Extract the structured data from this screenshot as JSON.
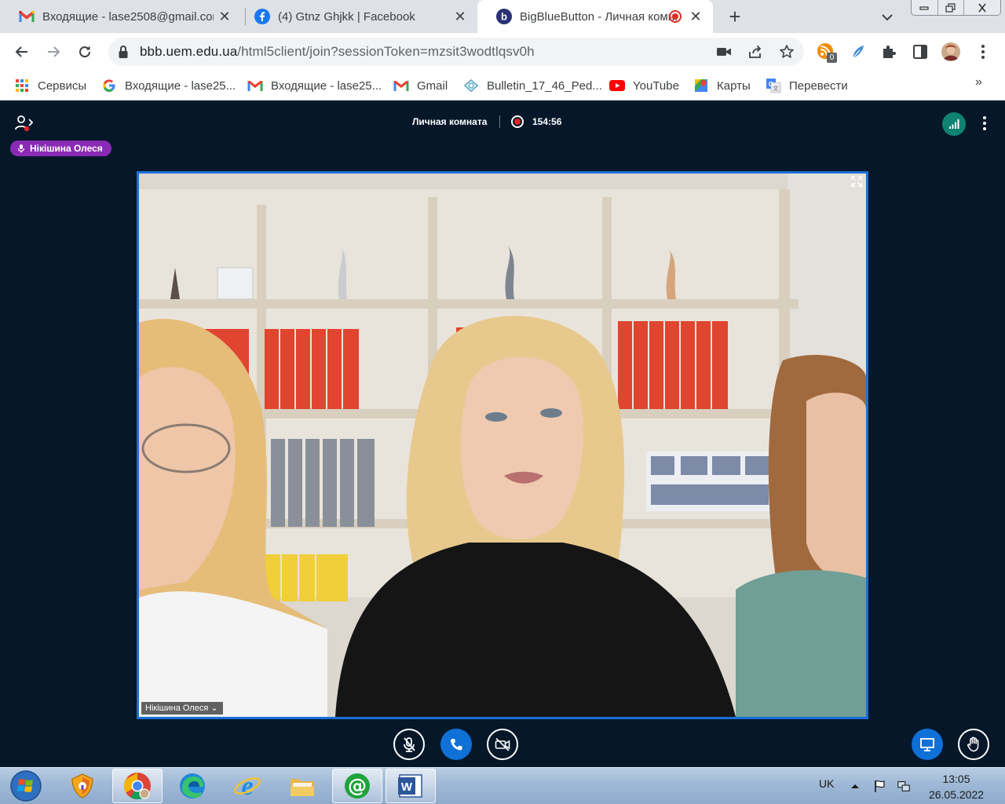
{
  "browser": {
    "tabs": [
      {
        "title": "Входящие - lase2508@gmail.com",
        "icon": "gmail-icon"
      },
      {
        "title": "(4) Gtnz Ghjkk | Facebook",
        "icon": "facebook-icon"
      },
      {
        "title": "BigBlueButton - Личная комната",
        "icon": "bigbluebutton-icon",
        "active": true,
        "recording": true
      }
    ],
    "url": {
      "host": "bbb.uem.edu.ua",
      "path": "/html5client/join?sessionToken=mzsit3wodtlqsv0h"
    },
    "extension_badge": "0",
    "bookmarks": [
      {
        "label": "Сервисы",
        "icon": "apps-grid-icon"
      },
      {
        "label": "Входящие - lase25...",
        "icon": "google-icon"
      },
      {
        "label": "Входящие - lase25...",
        "icon": "gmail-icon"
      },
      {
        "label": "Gmail",
        "icon": "gmail-icon"
      },
      {
        "label": "Bulletin_17_46_Ped...",
        "icon": "bulletin-icon"
      },
      {
        "label": "YouTube",
        "icon": "youtube-icon"
      },
      {
        "label": "Карты",
        "icon": "maps-icon"
      },
      {
        "label": "Перевести",
        "icon": "translate-icon"
      }
    ],
    "bookmarks_overflow": "»"
  },
  "meeting": {
    "room_name": "Личная комната",
    "recording_time": "154:56",
    "talking_user": "Нікішина Олеся",
    "video_label": "Нікішина Олеся ⌄",
    "colors": {
      "background": "#06172a",
      "accent": "#0f70d7",
      "talker": "#8a2bb5",
      "connection": "#0f8272",
      "recording": "#e02424"
    }
  },
  "taskbar": {
    "language": "UK",
    "time": "13:05",
    "date": "26.05.2022"
  }
}
